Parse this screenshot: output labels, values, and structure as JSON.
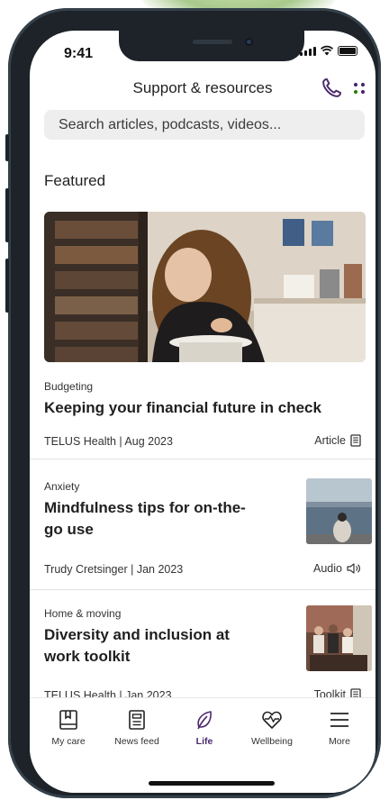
{
  "status": {
    "time": "9:41"
  },
  "header": {
    "title": "Support & resources"
  },
  "search": {
    "placeholder": "Search articles, podcasts, videos..."
  },
  "featured": {
    "title": "Featured"
  },
  "cards": [
    {
      "category": "Budgeting",
      "title": "Keeping your financial future in check",
      "meta": "TELUS Health | Aug 2023",
      "type": "Article"
    },
    {
      "category": "Anxiety",
      "title_line1": "Mindfulness tips for on-the-",
      "title_line2": "go use",
      "meta": "Trudy Cretsinger | Jan 2023",
      "type": "Audio"
    },
    {
      "category": "Home & moving",
      "title_line1": "Diversity and inclusion at",
      "title_line2": "work toolkit",
      "meta": "TELUS Health | Jan 2023",
      "type": "Toolkit"
    }
  ],
  "nav": {
    "items": [
      {
        "label": "My care",
        "icon": "book-icon"
      },
      {
        "label": "News feed",
        "icon": "newspaper-icon"
      },
      {
        "label": "Life",
        "icon": "leaf-icon"
      },
      {
        "label": "Wellbeing",
        "icon": "heart-pulse-icon"
      },
      {
        "label": "More",
        "icon": "menu-icon"
      }
    ],
    "active": "Life"
  },
  "colors": {
    "accent": "#4b286d",
    "accent_green": "#2b8000"
  }
}
